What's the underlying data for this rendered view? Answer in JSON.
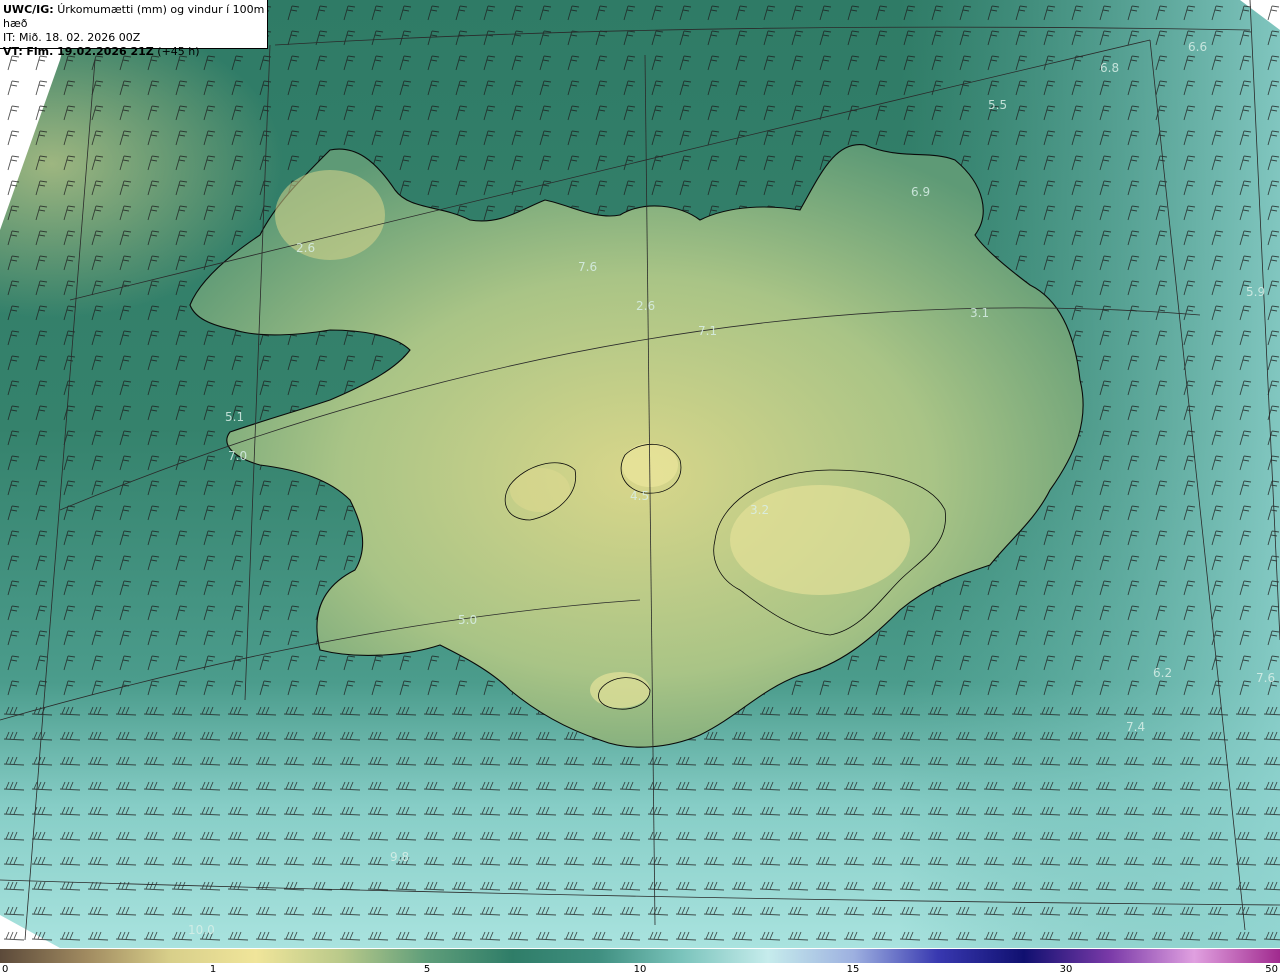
{
  "header": {
    "product_code": "UWC/IG:",
    "product_title": "Úrkomumætti (mm) og vindur í 100m hæð",
    "init_prefix": "IT:",
    "init_time": "Mið. 18. 02. 2026 00Z",
    "valid_prefix": "VT:",
    "valid_time": "Fim. 19.02.2026 21Z",
    "lead_time": "(+45 h)"
  },
  "map_labels": [
    "6.6",
    "5.5",
    "6.9",
    "5.9",
    "2.6",
    "7.6",
    "2.6",
    "7.1",
    "3.1",
    "5.1",
    "7.0",
    "5.0",
    "6.2",
    "7.6",
    "7.4",
    "9.8",
    "10.0",
    "4.5",
    "3.2",
    "6.8"
  ],
  "colorbar": {
    "ticks": [
      "0",
      "1",
      "5",
      "10",
      "15",
      "30",
      "50"
    ],
    "colors": [
      "#5c4a3a",
      "#a08a60",
      "#d8cf8a",
      "#f0e59a",
      "#b9c98a",
      "#5f9e7a",
      "#2f7d68",
      "#3f8f80",
      "#7bc4bc",
      "#c6ecec",
      "#9db0e0",
      "#3838b0",
      "#101070",
      "#7a3aa8",
      "#e0a0e0",
      "#a02a8e"
    ]
  },
  "colors": {
    "land_outline": "#0a0a0a",
    "grid": "#2a2a2a",
    "wind_barb": "#1a1a1a",
    "sea_low": "#2f7d68",
    "sea_high": "#8fd3cf"
  },
  "icons": [
    "wind-barb-icon"
  ]
}
